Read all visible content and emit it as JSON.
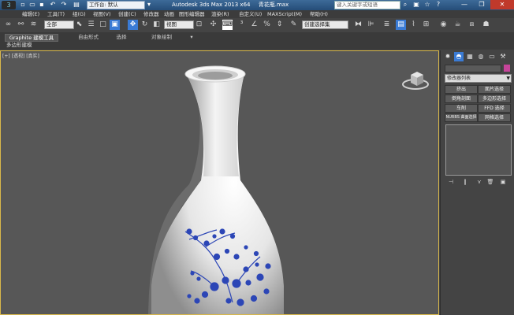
{
  "titlebar": {
    "app_logo": "3",
    "workspace": "工作台: 默认",
    "window_title": "Autodesk 3ds Max  2013 x64",
    "file_name": "青花瓶.max",
    "search_placeholder": "键入关键字或短语"
  },
  "menus": [
    "编辑(E)",
    "工具(T)",
    "组(G)",
    "视图(V)",
    "创建(C)",
    "修改器",
    "动画",
    "图形编辑器",
    "渲染(R)",
    "自定义(U)",
    "MAXScript(M)",
    "帮助(H)"
  ],
  "toolbar": {
    "filter": "全部",
    "coord": "视图",
    "selection_set": "创建选择集"
  },
  "ribbon": {
    "tabs": [
      "Graphite 建模工具",
      "自由形式",
      "选择",
      "对象绘制"
    ],
    "sub_label": "多边形建模"
  },
  "viewport": {
    "label": "[+] [透视] [真实]"
  },
  "command_panel": {
    "modifier_list": "修改器列表",
    "buttons": [
      "挤出",
      "面片选择",
      "倒角剖面",
      "多边形选择",
      "车削",
      "FFD 选择",
      "NURBS 曲面选择",
      "网格选择"
    ]
  },
  "colors": {
    "accent": "#c6449a",
    "vase_blue": "#2c46b6",
    "titlebar": "#2f5c8a"
  }
}
